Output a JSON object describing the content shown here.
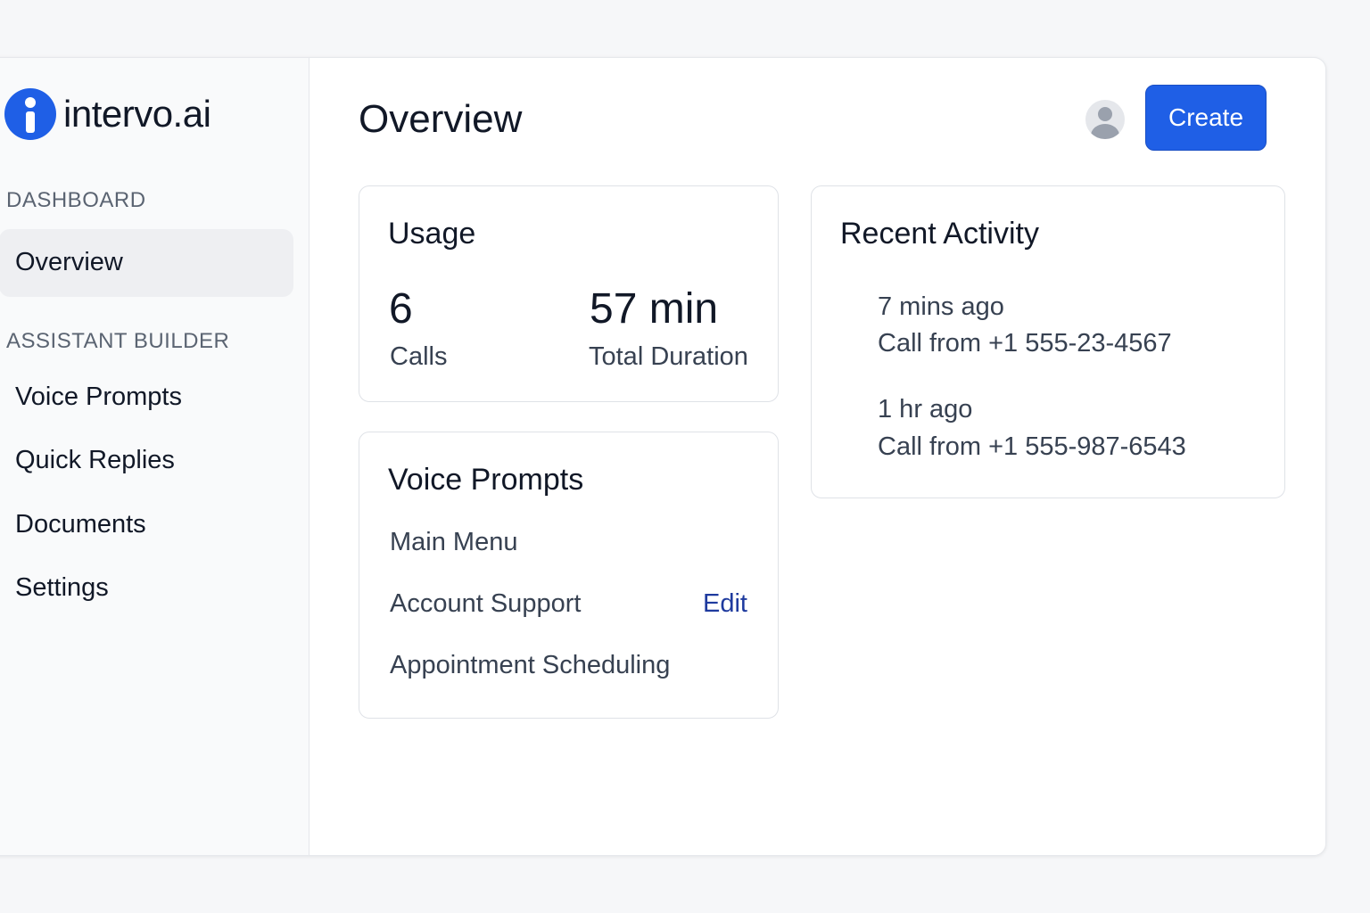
{
  "brand": {
    "name": "intervo.ai",
    "icon": "info-logo-icon",
    "accent": "#1f5fe6"
  },
  "sidebar": {
    "sections": [
      {
        "label": "DASHBOARD",
        "items": [
          {
            "label": "Overview",
            "active": true
          }
        ]
      },
      {
        "label": "ASSISTANT BUILDER",
        "items": [
          {
            "label": "Voice Prompts"
          },
          {
            "label": "Quick Replies"
          },
          {
            "label": "Documents"
          },
          {
            "label": "Settings"
          }
        ]
      }
    ]
  },
  "header": {
    "title": "Overview",
    "avatar_icon": "user-avatar-icon",
    "create_label": "Create"
  },
  "usage": {
    "title": "Usage",
    "stats": [
      {
        "value": "6",
        "label": "Calls"
      },
      {
        "value": "57 min",
        "label": "Total Duration"
      }
    ]
  },
  "voice_prompts": {
    "title": "Voice Prompts",
    "items": [
      "Main Menu",
      "Account Support",
      "Appointment Scheduling"
    ],
    "edit_label": "Edit"
  },
  "recent_activity": {
    "title": "Recent Activity",
    "items": [
      {
        "time": "7 mins ago",
        "description": "Call from +1 555-23-4567"
      },
      {
        "time": "1 hr ago",
        "description": "Call from +1 555-987-6543"
      }
    ]
  }
}
